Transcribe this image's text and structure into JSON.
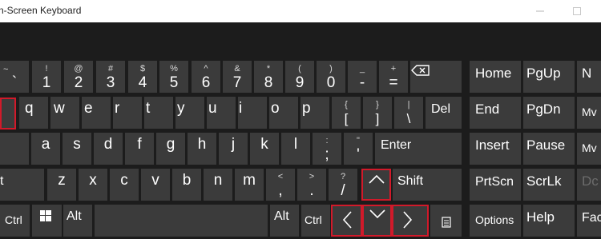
{
  "window": {
    "title": "n-Screen Keyboard"
  },
  "keys": {
    "grave": {
      "main": "`",
      "sub": "~"
    },
    "k1": {
      "main": "1",
      "sub": "!"
    },
    "k2": {
      "main": "2",
      "sub": "@"
    },
    "k3": {
      "main": "3",
      "sub": "#"
    },
    "k4": {
      "main": "4",
      "sub": "$"
    },
    "k5": {
      "main": "5",
      "sub": "%"
    },
    "k6": {
      "main": "6",
      "sub": "^"
    },
    "k7": {
      "main": "7",
      "sub": "&"
    },
    "k8": {
      "main": "8",
      "sub": "*"
    },
    "k9": {
      "main": "9",
      "sub": "("
    },
    "k0": {
      "main": "0",
      "sub": ")"
    },
    "minus": {
      "main": "-",
      "sub": "_"
    },
    "equal": {
      "main": "=",
      "sub": "+"
    },
    "q": {
      "main": "q"
    },
    "w": {
      "main": "w"
    },
    "e": {
      "main": "e"
    },
    "r": {
      "main": "r"
    },
    "t": {
      "main": "t"
    },
    "y": {
      "main": "y"
    },
    "u": {
      "main": "u"
    },
    "i": {
      "main": "i"
    },
    "o": {
      "main": "o"
    },
    "p": {
      "main": "p"
    },
    "lbracket": {
      "main": "[",
      "sub": "{"
    },
    "rbracket": {
      "main": "]",
      "sub": "}"
    },
    "backslash": {
      "main": "\\",
      "sub": "|"
    },
    "del": {
      "label": "Del"
    },
    "a": {
      "main": "a"
    },
    "s": {
      "main": "s"
    },
    "d": {
      "main": "d"
    },
    "f": {
      "main": "f"
    },
    "g": {
      "main": "g"
    },
    "h": {
      "main": "h"
    },
    "j": {
      "main": "j"
    },
    "k": {
      "main": "k"
    },
    "l": {
      "main": "l"
    },
    "semicolon": {
      "main": ";",
      "sub": ":"
    },
    "quote": {
      "main": "'",
      "sub": "\""
    },
    "enter": {
      "label": "Enter"
    },
    "shift_left_frag": {
      "label": "t"
    },
    "z": {
      "main": "z"
    },
    "x": {
      "main": "x"
    },
    "c": {
      "main": "c"
    },
    "v": {
      "main": "v"
    },
    "b": {
      "main": "b"
    },
    "n": {
      "main": "n"
    },
    "m": {
      "main": "m"
    },
    "comma": {
      "main": ",",
      "sub": "<"
    },
    "period": {
      "main": ".",
      "sub": ">"
    },
    "slash": {
      "main": "/",
      "sub": "?"
    },
    "shift_right": {
      "label": "Shift"
    },
    "ctrl_left": {
      "label": "Ctrl"
    },
    "alt_left": {
      "label": "Alt"
    },
    "alt_right": {
      "label": "Alt"
    },
    "ctrl_right": {
      "label": "Ctrl"
    }
  },
  "nav": {
    "home": "Home",
    "pgup": "PgUp",
    "end": "End",
    "pgdn": "PgDn",
    "insert": "Insert",
    "pause": "Pause",
    "prtscn": "PrtScn",
    "scrlk": "ScrLk",
    "options": "Options",
    "help": "Help"
  },
  "edge": {
    "n_frag": "N",
    "mv1": "Mv",
    "mv2": "Mv",
    "dc": "Dc",
    "fad": "Fac"
  },
  "colors": {
    "key_bg": "#3b3b3b",
    "board_bg": "#1c1c1c",
    "highlight": "#d11a2a"
  }
}
